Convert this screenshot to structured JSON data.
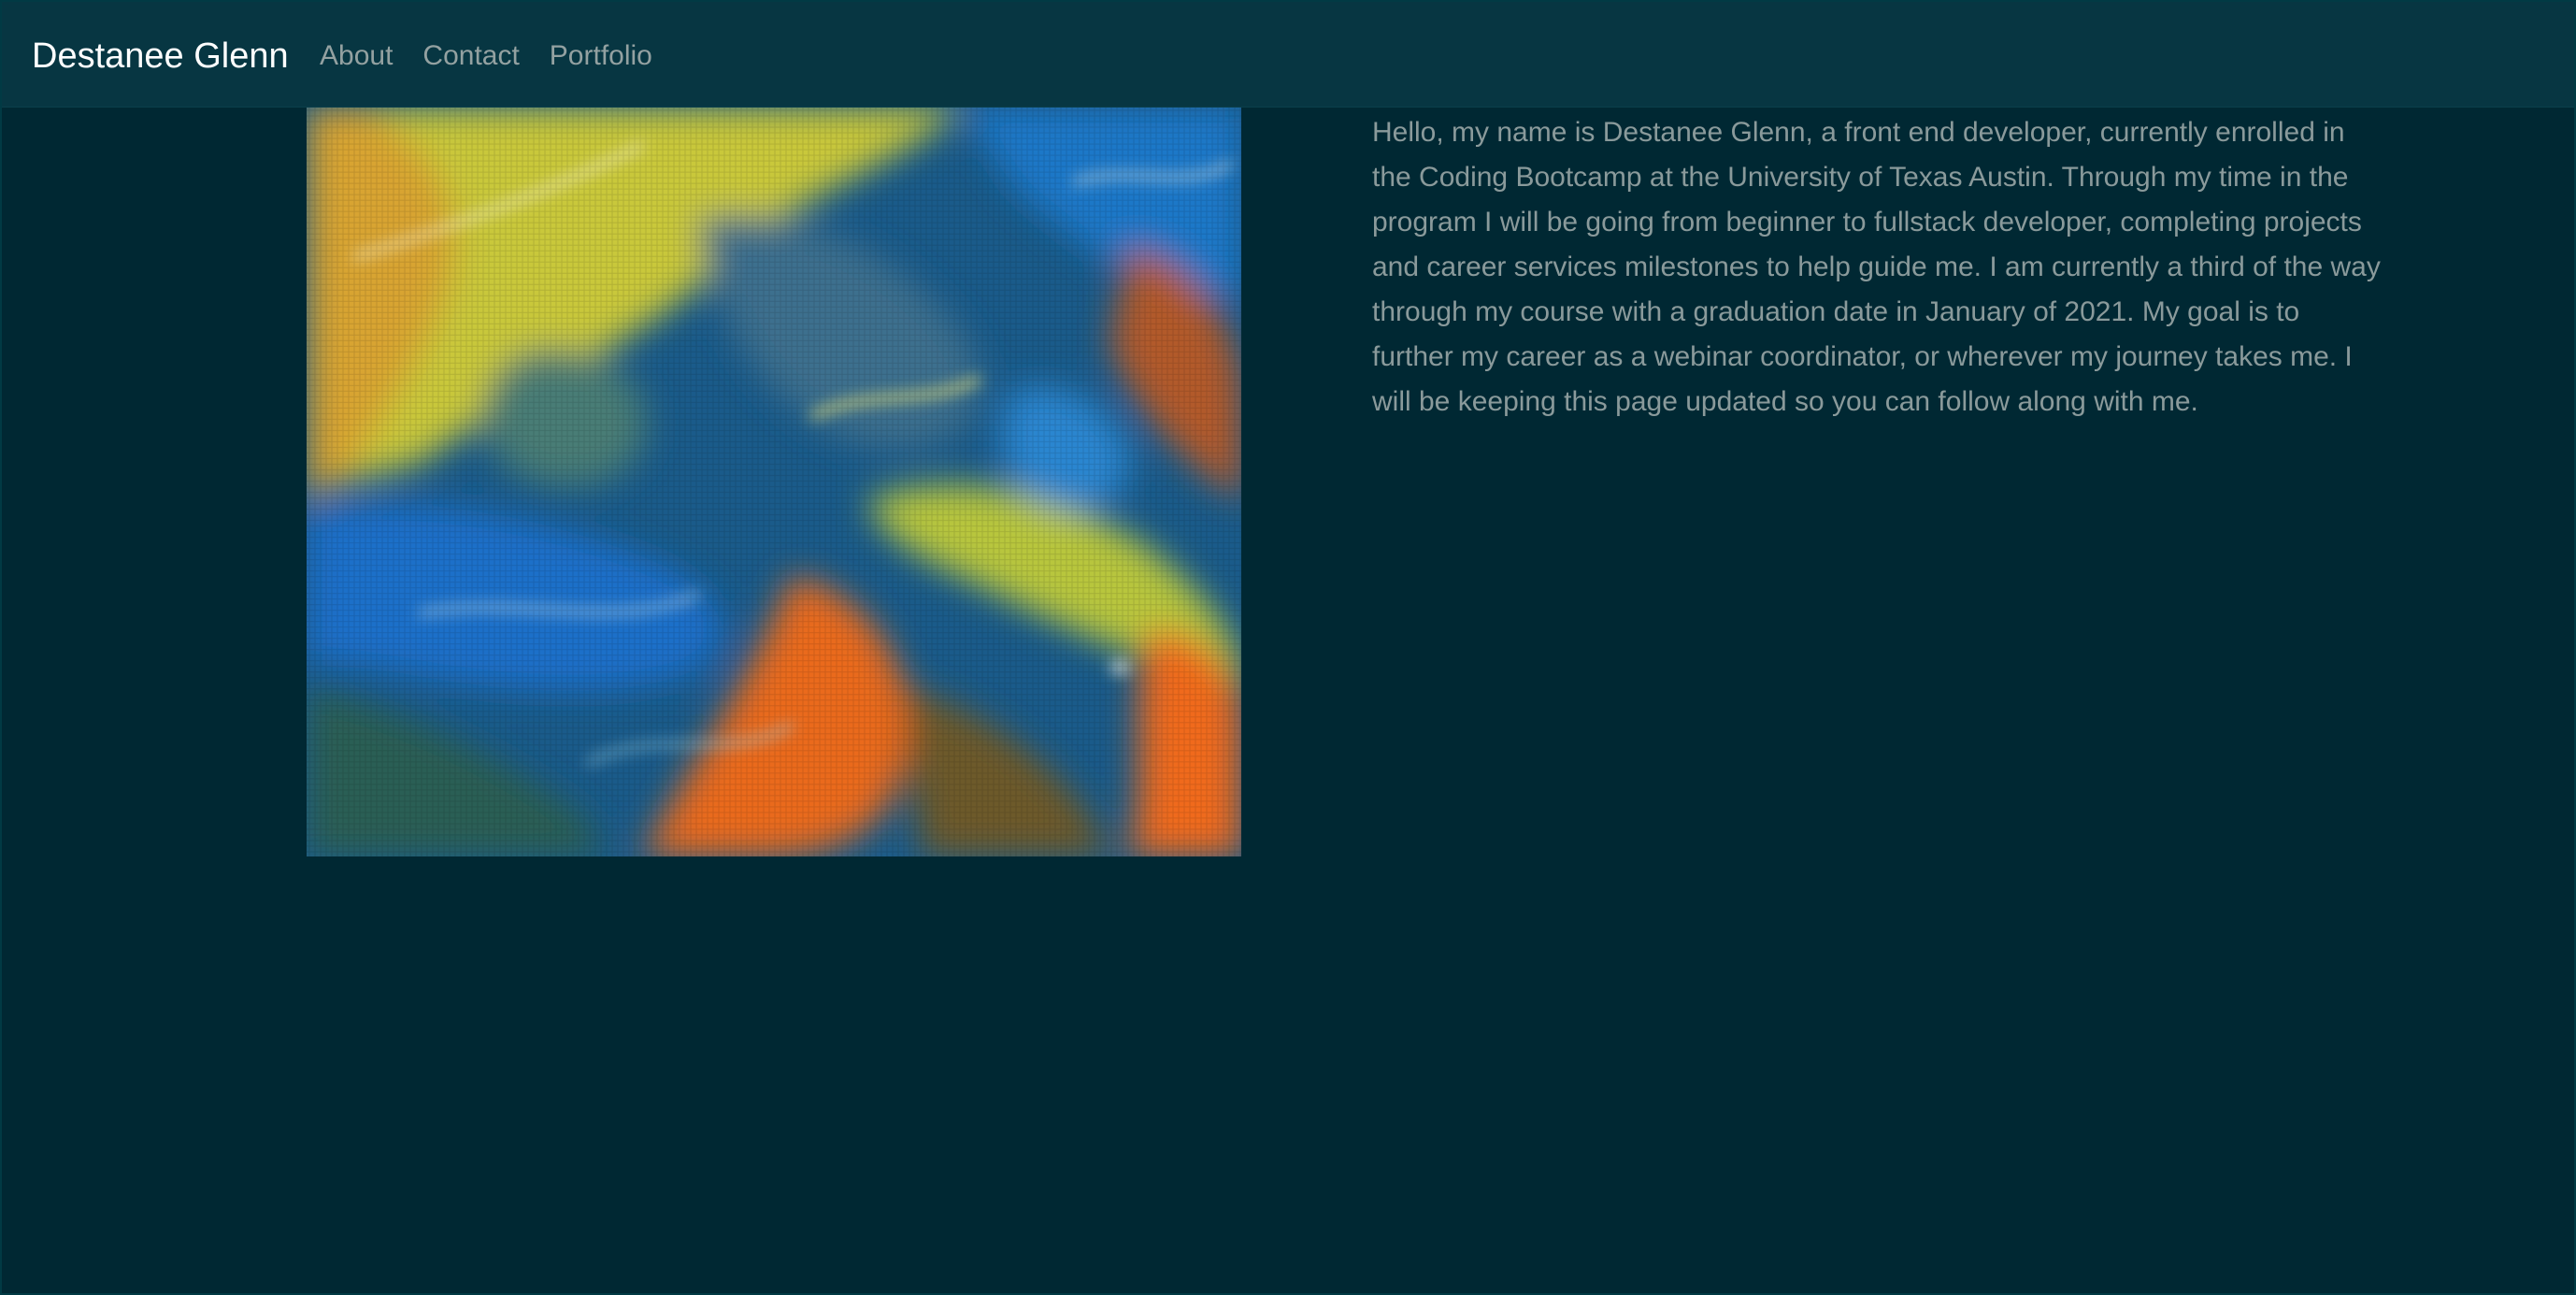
{
  "navbar": {
    "brand": "Destanee Glenn",
    "links": [
      {
        "label": "About"
      },
      {
        "label": "Contact"
      },
      {
        "label": "Portfolio"
      }
    ]
  },
  "main": {
    "image_description": "abstract acrylic pour painting in blue, yellow-green and orange",
    "bio": "Hello, my name is Destanee Glenn, a front end developer, currently enrolled in the Coding Bootcamp at the University of Texas Austin. Through my time in the program I will be going from beginner to fullstack developer, completing projects and career services milestones to help guide me. I am currently a third of the way through my course with a graduation date in January of 2021. My goal is to further my career as a webinar coordinator, or wherever my journey takes me. I will be keeping this page updated so you can follow along with me."
  },
  "colors": {
    "background": "#002833",
    "navbar": "#073642",
    "brand_text": "#ffffff",
    "nav_text": "#93a1a1",
    "body_text": "#8a9a9b"
  }
}
